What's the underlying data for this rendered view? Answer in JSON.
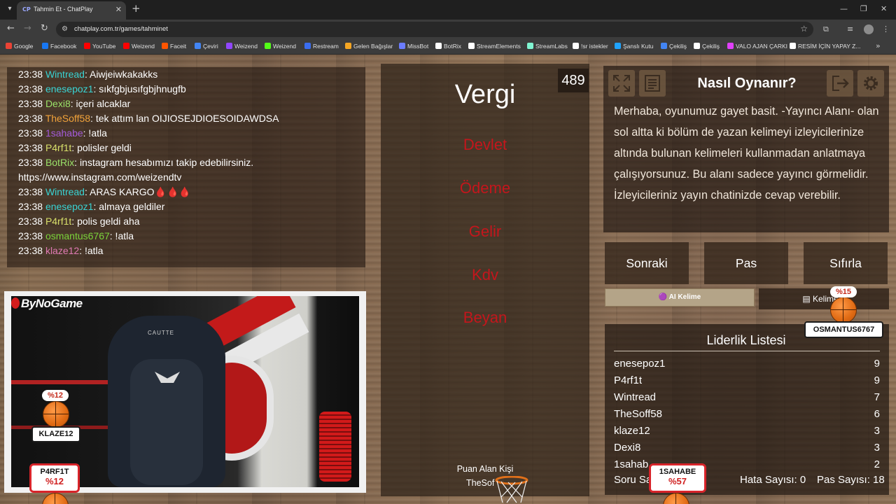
{
  "browser": {
    "tab_title": "Tahmin Et - ChatPlay",
    "tab_favicon": "CP",
    "url": "chatplay.com.tr/games/tahminet",
    "bookmarks": [
      {
        "label": "Google",
        "color": "#ea4335"
      },
      {
        "label": "Facebook",
        "color": "#1877f2"
      },
      {
        "label": "YouTube",
        "color": "#ff0000"
      },
      {
        "label": "Weizend",
        "color": "#ff0000"
      },
      {
        "label": "Faceit",
        "color": "#ff5500"
      },
      {
        "label": "Çeviri",
        "color": "#4285f4"
      },
      {
        "label": "Weizend",
        "color": "#9146ff"
      },
      {
        "label": "Weizend",
        "color": "#53fc18"
      },
      {
        "label": "Restream",
        "color": "#3a6df0"
      },
      {
        "label": "Gelen Bağışlar",
        "color": "#f5a623"
      },
      {
        "label": "MissBot",
        "color": "#6b7cff"
      },
      {
        "label": "BotRix",
        "color": "#ffffff"
      },
      {
        "label": "StreamElements",
        "color": "#ffffff"
      },
      {
        "label": "StreamLabs",
        "color": "#80f5d2"
      },
      {
        "label": "!sr istekler",
        "color": "#ffffff"
      },
      {
        "label": "Şanslı Kutu",
        "color": "#1fa3ff"
      },
      {
        "label": "Çekiliş",
        "color": "#4285f4"
      },
      {
        "label": "Çekiliş",
        "color": "#ffffff"
      },
      {
        "label": "VALO AJAN ÇARKI",
        "color": "#e040fb"
      },
      {
        "label": "RESİM İÇİN YAPAY Z...",
        "color": "#ffffff"
      }
    ]
  },
  "chat": {
    "messages": [
      {
        "time": "23:38",
        "user": "Wintread",
        "color": "#39d4d4",
        "text": ": Aiwjeiwkakakks"
      },
      {
        "time": "23:38",
        "user": "enesepoz1",
        "color": "#39d4d4",
        "text": ": sıkfgbjusıfgbjhnugfb"
      },
      {
        "time": "23:38",
        "user": "Dexi8",
        "color": "#9be36a",
        "text": ": içeri alcaklar"
      },
      {
        "time": "23:38",
        "user": "TheSoff58",
        "color": "#f2a33a",
        "text": ": tek attım lan OIJIOSEJDIOESOIDAWDSA"
      },
      {
        "time": "23:38",
        "user": "1sahabe",
        "color": "#a35ad8",
        "text": ": !atla"
      },
      {
        "time": "23:38",
        "user": "P4rf1t",
        "color": "#d8e06a",
        "text": ": polisler geldi"
      },
      {
        "time": "23:38",
        "user": "BotRix",
        "color": "#9be36a",
        "text": ": instagram hesabımızı takip edebilirsiniz."
      },
      {
        "time": "",
        "user": "",
        "color": "#ffffff",
        "text": "https://www.instagram.com/weizendtv"
      },
      {
        "time": "23:38",
        "user": "Wintread",
        "color": "#39d4d4",
        "text": ": ARAS KARGO🩸🩸🩸"
      },
      {
        "time": "23:38",
        "user": "enesepoz1",
        "color": "#39d4d4",
        "text": ": almaya geldiler"
      },
      {
        "time": "23:38",
        "user": "P4rf1t",
        "color": "#d8e06a",
        "text": ": polis geldi aha"
      },
      {
        "time": "23:38",
        "user": "osmantus6767",
        "color": "#7bd33a",
        "text": ": !atla"
      },
      {
        "time": "23:38",
        "user": "klaze12",
        "color": "#e07ab4",
        "text": ": !atla"
      }
    ]
  },
  "webcam": {
    "logo": "ByNoGame",
    "chair_brand": "CAUTTE"
  },
  "game": {
    "timer": "489",
    "word": "Vergi",
    "taboo_words": [
      "Devlet",
      "Ödeme",
      "Gelir",
      "Kdv",
      "Beyan"
    ],
    "scored_label": "Puan Alan Kişi",
    "scored_value": "TheSof"
  },
  "howto": {
    "title": "Nasıl Oynanır?",
    "text": "Merhaba, oyunumuz gayet basit. -Yayıncı Alanı- olan sol altta ki bölüm de yazan kelimeyi izleyicilerinize altında bulunan kelimeleri kullanmadan anlatmaya çalışıyorsunuz. Bu alanı sadece yayıncı görmelidir. İzleyicileriniz yayın chatinizde cevap verebilir."
  },
  "controls": {
    "next": "Sonraki",
    "pass": "Pas",
    "reset": "Sıfırla",
    "ai_word": "🟣 AI Kelime",
    "word_list": "Kelime L"
  },
  "leaderboard": {
    "title": "Liderlik Listesi",
    "rows": [
      {
        "name": "enesepoz1",
        "score": "9"
      },
      {
        "name": "P4rf1t",
        "score": "9"
      },
      {
        "name": "Wintread",
        "score": "7"
      },
      {
        "name": "TheSoff58",
        "score": "6"
      },
      {
        "name": "klaze12",
        "score": "3"
      },
      {
        "name": "Dexi8",
        "score": "3"
      },
      {
        "name": "1sahab",
        "score": "2"
      }
    ],
    "question_count_label": "Soru Sa",
    "errors_label": "Hata Sayısı: 0",
    "passes_label": "Pas Sayısı: 18"
  },
  "overlays": {
    "osmantus": {
      "name": "OSMANTUS6767",
      "pct": "%15"
    },
    "klaze": {
      "name": "KLAZE12",
      "pct": "%12"
    },
    "p4rf1t": {
      "name": "P4RF1T",
      "pct": "%12"
    },
    "sahabe": {
      "name": "1SAHABE",
      "pct": "%57"
    }
  }
}
